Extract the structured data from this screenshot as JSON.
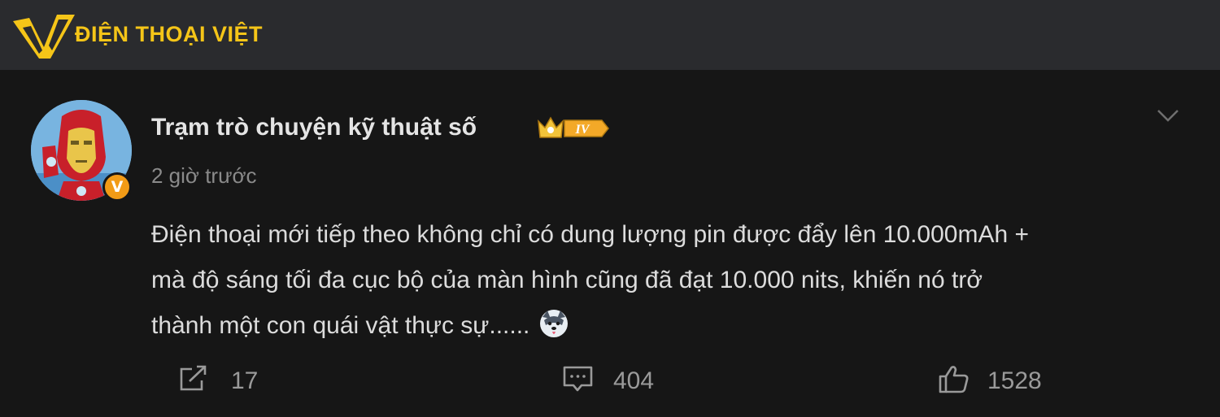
{
  "header": {
    "brand": "ĐIỆN THOẠI VIỆT",
    "brand_color": "#f5c518",
    "logo_icon": "v-logo-icon"
  },
  "post": {
    "author": "Trạm trò chuyện kỹ thuật số",
    "level_badge": "IV",
    "verified_mark": "V",
    "time": "2 giờ trước",
    "content_lines": [
      "Điện thoại mới tiếp theo không chỉ có dung lượng pin được đẩy lên 10.000mAh +",
      "mà độ sáng tối đa cục bộ của màn hình cũng đã đạt 10.000 nits, khiến nó trở",
      "thành một con quái vật thực sự......"
    ],
    "emoji": "dog-emoji-icon"
  },
  "actions": {
    "share_count": "17",
    "comment_count": "404",
    "like_count": "1528"
  }
}
